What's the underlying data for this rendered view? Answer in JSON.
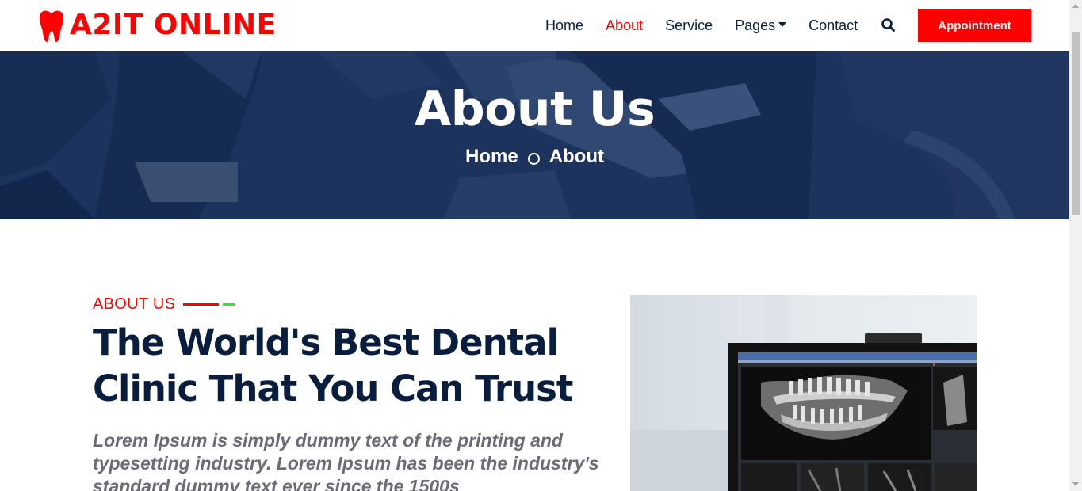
{
  "brand": {
    "name": "A2IT ONLINE",
    "color": "#ff0000"
  },
  "nav": {
    "items": [
      {
        "label": "Home",
        "active": false
      },
      {
        "label": "About",
        "active": true
      },
      {
        "label": "Service",
        "active": false
      },
      {
        "label": "Pages",
        "active": false,
        "dropdown": true
      },
      {
        "label": "Contact",
        "active": false
      }
    ],
    "search_icon": "search-icon",
    "cta_label": "Appointment"
  },
  "hero": {
    "title": "About Us",
    "breadcrumb": [
      "Home",
      "About"
    ],
    "separator_icon": "circle-outline-icon"
  },
  "about": {
    "label": "ABOUT US",
    "heading": "The World's Best Dental Clinic That You Can Trust",
    "text": "Lorem Ipsum is simply dummy text of the printing and typesetting industry. Lorem Ipsum has been the industry's standard dummy text ever since the 1500s"
  },
  "colors": {
    "accent": "#ff0000",
    "navy": "#091e3e",
    "hero_overlay": "#21355a",
    "green_accent": "#2ee62e"
  }
}
